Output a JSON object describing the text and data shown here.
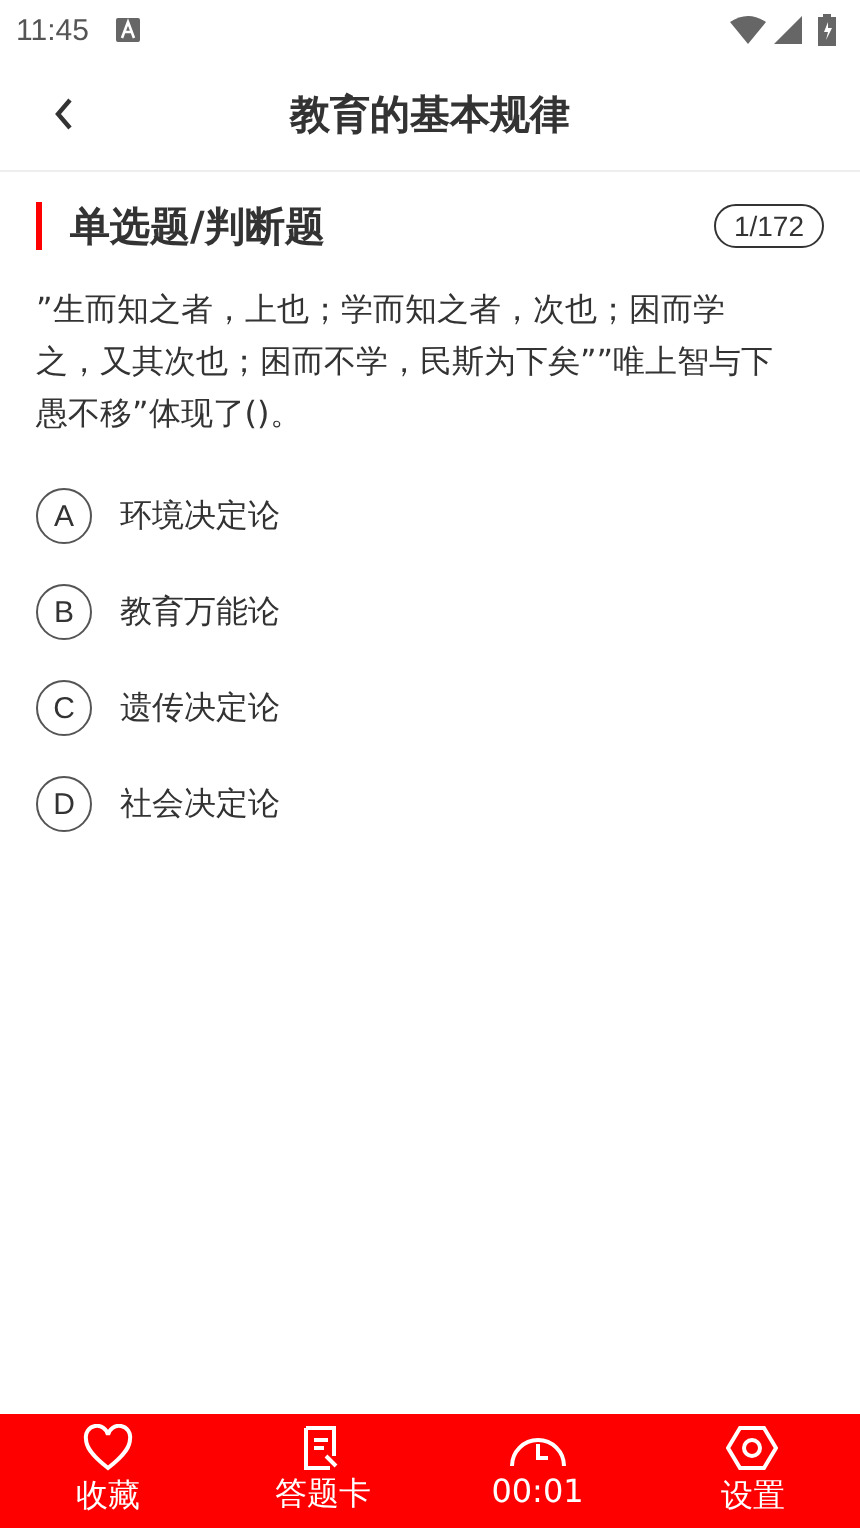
{
  "status_bar": {
    "time": "11:45"
  },
  "header": {
    "title": "教育的基本规律"
  },
  "question": {
    "type_label": "单选题/判断题",
    "counter": "1/172",
    "text": "”生而知之者，上也；学而知之者，次也；困而学之，又其次也；困而不学，民斯为下矣””唯上智与下愚不移”体现了()。"
  },
  "options": [
    {
      "letter": "A",
      "text": "环境决定论"
    },
    {
      "letter": "B",
      "text": "教育万能论"
    },
    {
      "letter": "C",
      "text": "遗传决定论"
    },
    {
      "letter": "D",
      "text": "社会决定论"
    }
  ],
  "bottom_bar": [
    {
      "label": "收藏"
    },
    {
      "label": "答题卡"
    },
    {
      "label": "00:01"
    },
    {
      "label": "设置"
    }
  ]
}
